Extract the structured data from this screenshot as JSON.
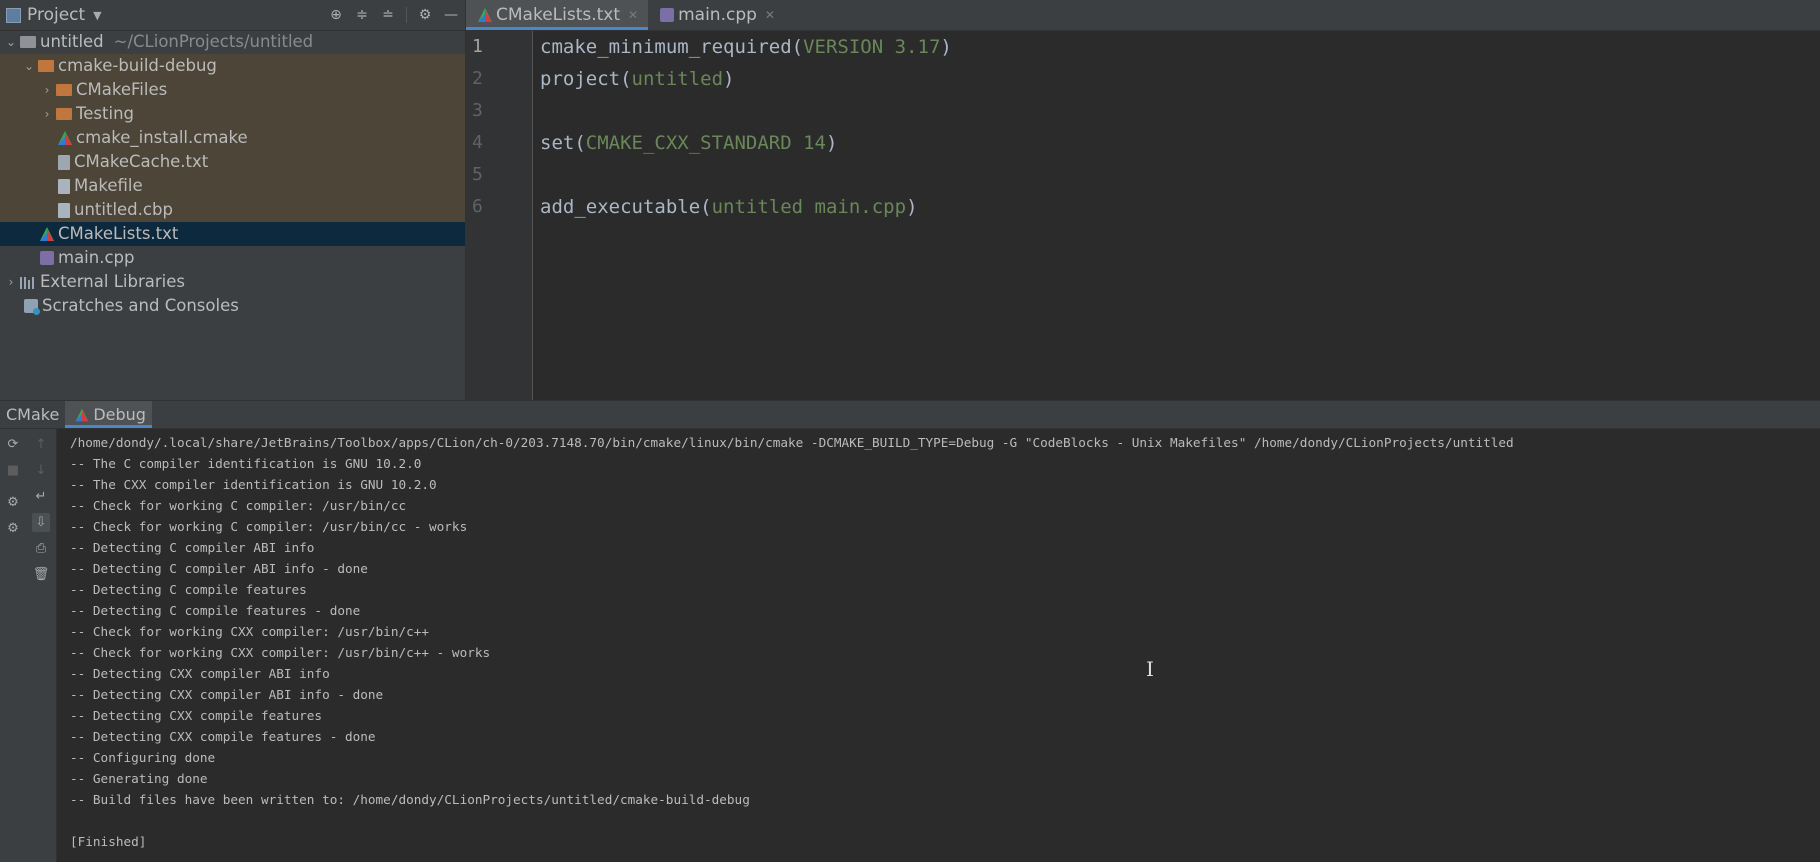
{
  "project_panel": {
    "title": "Project",
    "tree": [
      {
        "label": "untitled",
        "path": "~/CLionProjects/untitled"
      },
      {
        "label": "cmake-build-debug"
      },
      {
        "label": "CMakeFiles"
      },
      {
        "label": "Testing"
      },
      {
        "label": "cmake_install.cmake"
      },
      {
        "label": "CMakeCache.txt"
      },
      {
        "label": "Makefile"
      },
      {
        "label": "untitled.cbp"
      },
      {
        "label": "CMakeLists.txt"
      },
      {
        "label": "main.cpp"
      },
      {
        "label": "External Libraries"
      },
      {
        "label": "Scratches and Consoles"
      }
    ]
  },
  "editor": {
    "tabs": [
      {
        "label": "CMakeLists.txt",
        "active": true
      },
      {
        "label": "main.cpp",
        "active": false
      }
    ],
    "line_numbers": [
      "1",
      "2",
      "3",
      "4",
      "5",
      "6"
    ],
    "code": [
      {
        "fn": "cmake_minimum_required(",
        "arg": "VERSION 3.17",
        "end": ")"
      },
      {
        "fn": "project(",
        "arg": "untitled",
        "end": ")"
      },
      {
        "fn": "",
        "arg": "",
        "end": ""
      },
      {
        "fn": "set(",
        "arg": "CMAKE_CXX_STANDARD 14",
        "end": ")"
      },
      {
        "fn": "",
        "arg": "",
        "end": ""
      },
      {
        "fn": "add_executable(",
        "arg": "untitled main.cpp",
        "end": ")"
      }
    ]
  },
  "bottom_panel": {
    "tabs": [
      "CMake",
      "Debug"
    ],
    "output": [
      "/home/dondy/.local/share/JetBrains/Toolbox/apps/CLion/ch-0/203.7148.70/bin/cmake/linux/bin/cmake -DCMAKE_BUILD_TYPE=Debug -G \"CodeBlocks - Unix Makefiles\" /home/dondy/CLionProjects/untitled",
      "-- The C compiler identification is GNU 10.2.0",
      "-- The CXX compiler identification is GNU 10.2.0",
      "-- Check for working C compiler: /usr/bin/cc",
      "-- Check for working C compiler: /usr/bin/cc - works",
      "-- Detecting C compiler ABI info",
      "-- Detecting C compiler ABI info - done",
      "-- Detecting C compile features",
      "-- Detecting C compile features - done",
      "-- Check for working CXX compiler: /usr/bin/c++",
      "-- Check for working CXX compiler: /usr/bin/c++ - works",
      "-- Detecting CXX compiler ABI info",
      "-- Detecting CXX compiler ABI info - done",
      "-- Detecting CXX compile features",
      "-- Detecting CXX compile features - done",
      "-- Configuring done",
      "-- Generating done",
      "-- Build files have been written to: /home/dondy/CLionProjects/untitled/cmake-build-debug",
      "",
      "[Finished]"
    ]
  },
  "colors": {
    "accent": "#4a88c7",
    "selection": "#0d293e",
    "build_dir_highlight": "#4c4538",
    "string_arg": "#6a8759"
  }
}
